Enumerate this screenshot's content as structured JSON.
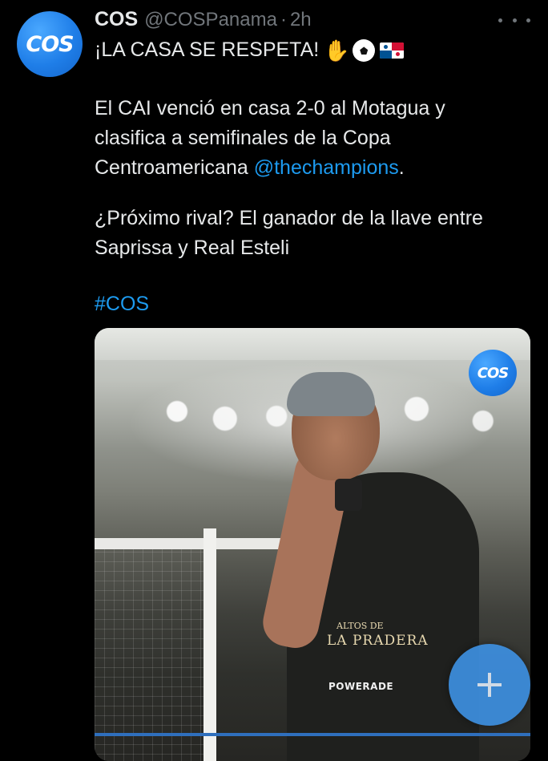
{
  "tweet": {
    "author": {
      "avatar_text": "COS",
      "display_name": "COS",
      "handle": "@COSPanama",
      "separator": "·",
      "time": "2h"
    },
    "more_icon": "more-horizontal-icon",
    "text": {
      "headline": "¡LA CASA SE RESPETA!",
      "emojis": [
        "waving-hand-emoji",
        "soccer-ball-emoji",
        "panama-flag-emoji"
      ],
      "p1_l1": "El CAI venció en casa 2-0 al Motagua y",
      "p1_l2": "clasifica a semifinales de la Copa",
      "p1_l3_text": "Centroamericana ",
      "p1_l3_mention": "@thechampions",
      "p1_l3_end": ".",
      "p2_l1": "¿Próximo rival? El ganador de la llave entre",
      "p2_l2": "Saprissa y Real Esteli",
      "hashtag": "#COS"
    },
    "media": {
      "watermark_text": "COS",
      "jersey_small": "ALTOS DE",
      "jersey_sponsor": "LA PRADERA",
      "jersey_powerade": "POWERADE"
    }
  },
  "compose_button": {
    "icon": "plus-icon"
  },
  "colors": {
    "background": "#000000",
    "text": "#e7e9ea",
    "muted": "#71767b",
    "link": "#1d9bf0",
    "brand_blue": "#1f7ee8"
  }
}
